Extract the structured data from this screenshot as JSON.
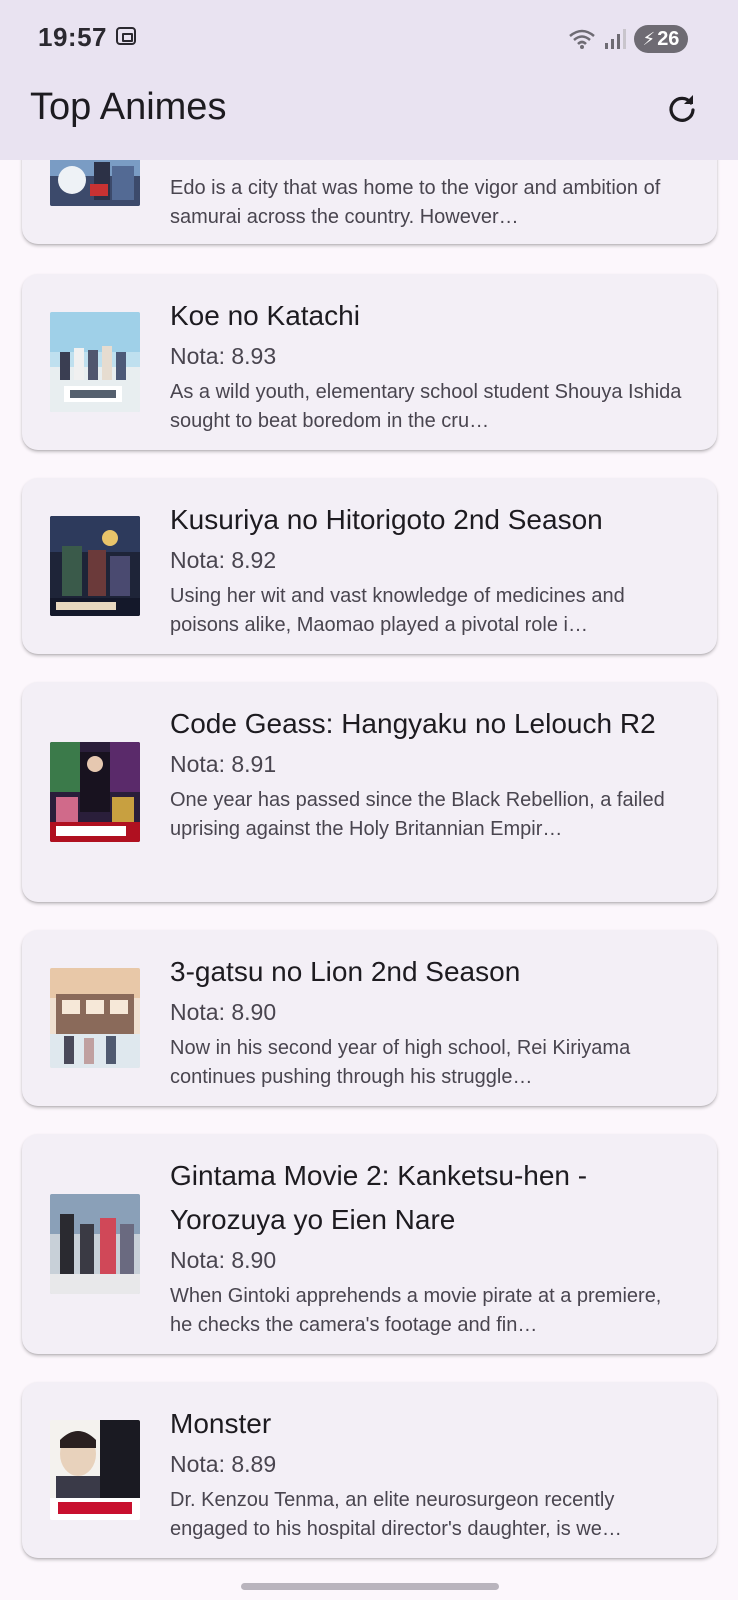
{
  "status_bar": {
    "time": "19:57",
    "battery": "26"
  },
  "app_bar": {
    "title": "Top Animes",
    "refresh_icon": "refresh-icon"
  },
  "animes": [
    {
      "title": "",
      "score": "",
      "synopsis": "Edo is a city that was home to the vigor and ambition of samurai across the country. However…"
    },
    {
      "title": "Koe no Katachi",
      "score": "Nota: 8.93",
      "synopsis": "As a wild youth, elementary school student Shouya Ishida sought to beat boredom in the cru…"
    },
    {
      "title": "Kusuriya no Hitorigoto 2nd Season",
      "score": "Nota: 8.92",
      "synopsis": "Using her wit and vast knowledge of medicines and poisons alike, Maomao played a pivotal role i…"
    },
    {
      "title": "Code Geass: Hangyaku no Lelouch R2",
      "score": "Nota: 8.91",
      "synopsis": "One year has passed since the Black Rebellion, a failed uprising against the Holy Britannian Empir…"
    },
    {
      "title": "3-gatsu no Lion 2nd Season",
      "score": "Nota: 8.90",
      "synopsis": "Now in his second year of high school, Rei Kiriyama continues pushing through his struggle…"
    },
    {
      "title": "Gintama Movie 2: Kanketsu-hen - Yorozuya yo Eien Nare",
      "score": "Nota: 8.90",
      "synopsis": "When Gintoki apprehends a movie pirate at a premiere, he checks the camera's footage and fin…"
    },
    {
      "title": "Monster",
      "score": "Nota: 8.89",
      "synopsis": "Dr. Kenzou Tenma, an elite neurosurgeon recently engaged to his hospital director's daughter, is we…"
    }
  ]
}
